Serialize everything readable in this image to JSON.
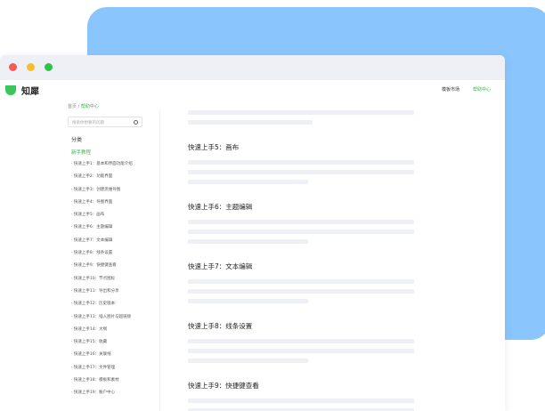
{
  "app": {
    "name": "知犀",
    "nav": [
      "模板市场",
      "帮助中心"
    ]
  },
  "breadcrumb": {
    "home": "首页",
    "current": "帮助中心"
  },
  "search": {
    "placeholder": "搜索你想要的问题"
  },
  "sidebar": {
    "category": "分类",
    "section": "新手教程",
    "items": [
      "快速上手1：基本和界面功能介绍",
      "快速上手2：功能界面",
      "快速上手3：创建思维导图",
      "快速上手4：导图界面",
      "快速上手5：画布",
      "快速上手6：主题编辑",
      "快速上手7：文本编辑",
      "快速上手8：线条设置",
      "快速上手9：快捷键查看",
      "快速上手10：节点图标",
      "快速上手11：导出和分享",
      "快速上手12：历史版本",
      "快速上手13：插入图片与超链接",
      "快速上手14：大纲",
      "快速上手15：收藏",
      "快速上手16：关联线",
      "快速上手17：文件管理",
      "快速上手18：模板和素材",
      "快速上手19：账户中心"
    ]
  },
  "main": {
    "headings": [
      "快速上手5：画布",
      "快速上手6：主题编辑",
      "快速上手7：文本编辑",
      "快速上手8：线条设置",
      "快速上手9：快捷键查看"
    ]
  },
  "colors": {
    "accent": "#3bb54a",
    "backdrop": "#8ac6fd"
  }
}
